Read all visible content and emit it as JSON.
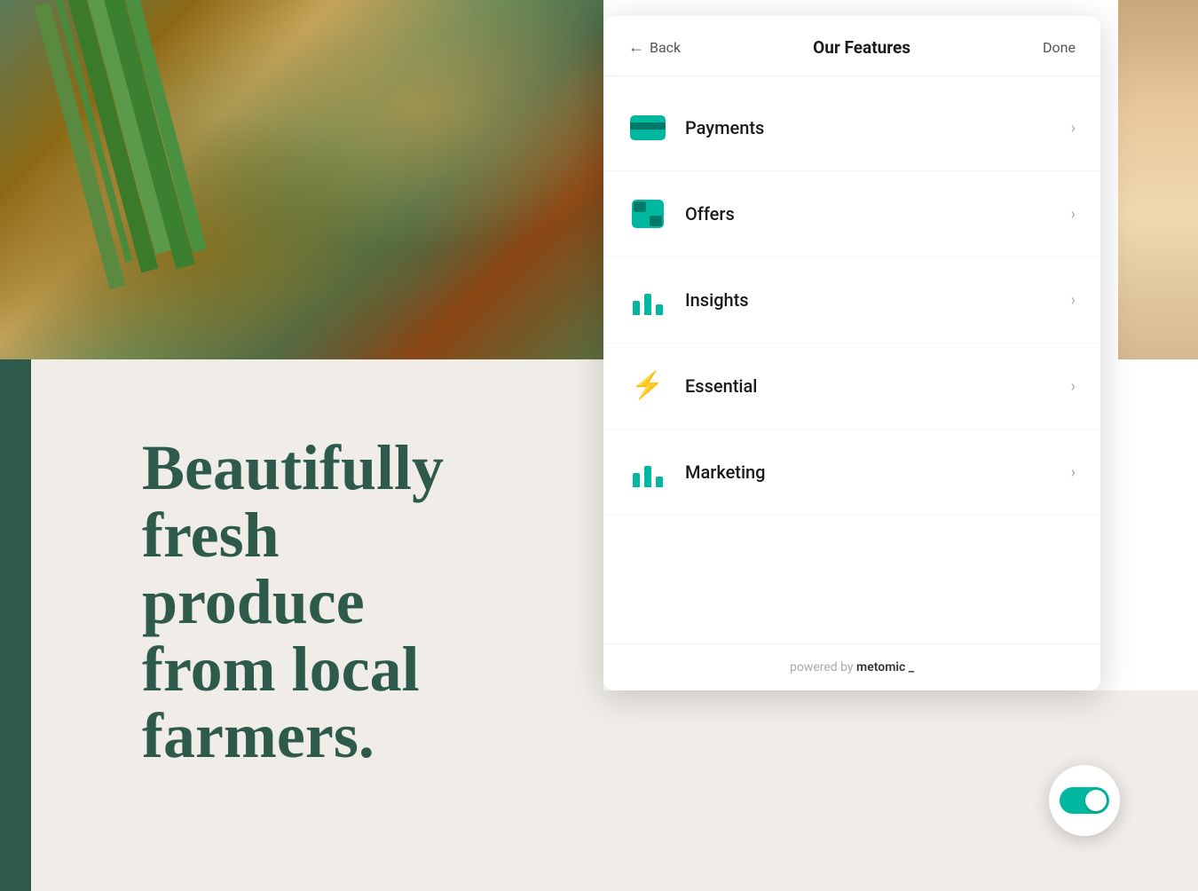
{
  "panel": {
    "title": "Our Features",
    "back_label": "Back",
    "done_label": "Done",
    "menu_items": [
      {
        "id": "payments",
        "label": "Payments",
        "icon": "payments-icon"
      },
      {
        "id": "offers",
        "label": "Offers",
        "icon": "offers-icon"
      },
      {
        "id": "insights",
        "label": "Insights",
        "icon": "insights-icon"
      },
      {
        "id": "essential",
        "label": "Essential",
        "icon": "essential-icon"
      },
      {
        "id": "marketing",
        "label": "Marketing",
        "icon": "marketing-icon"
      }
    ],
    "footer": {
      "powered_by": "powered by",
      "brand": "metomic _"
    }
  },
  "hero": {
    "line1": "Beautifully",
    "line2": "fresh",
    "line3": "produce",
    "line4": "from local",
    "line5": "farmers."
  },
  "toggle": {
    "state": "on"
  }
}
